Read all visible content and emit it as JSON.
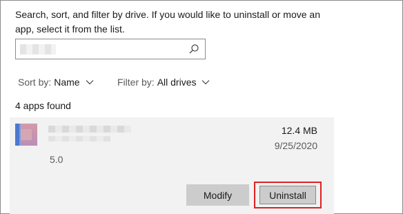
{
  "description": "Search, sort, and filter by drive. If you would like to uninstall or move an app, select it from the list.",
  "search": {
    "placeholder": ""
  },
  "sort": {
    "label": "Sort by:",
    "value": "Name"
  },
  "filter": {
    "label": "Filter by:",
    "value": "All drives"
  },
  "apps_count": "4 apps found",
  "app": {
    "size": "12.4 MB",
    "date": "9/25/2020",
    "version": "5.0",
    "modify_label": "Modify",
    "uninstall_label": "Uninstall"
  },
  "colors": {
    "card_background": "#f2f2f2",
    "button_background": "#cccccc",
    "highlight_border": "#e02020"
  },
  "icons": [
    "search-icon",
    "chevron-down-icon",
    "app-icon"
  ]
}
